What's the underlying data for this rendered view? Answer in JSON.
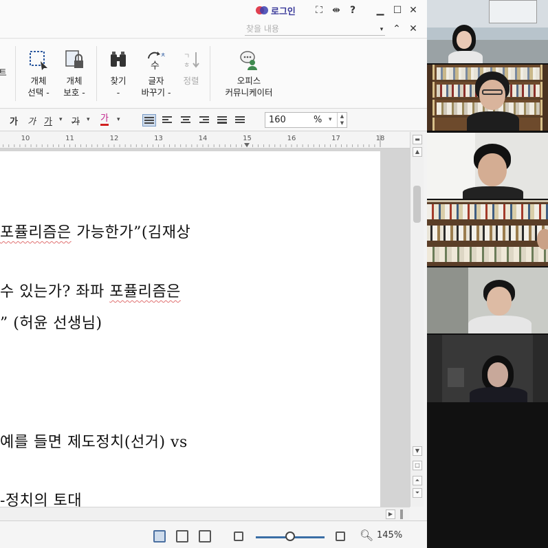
{
  "titlebar": {
    "login_label": "로그인",
    "icons": [
      "fullscreen-icon",
      "split-icon",
      "help-icon",
      "minimize-icon",
      "maximize-icon",
      "close-icon"
    ],
    "help_glyph": "?"
  },
  "search": {
    "placeholder": "찾을 내용"
  },
  "ribbon": {
    "partial_label": "트",
    "object_select": {
      "line1": "개체",
      "line2": "선택 -"
    },
    "object_protect": {
      "line1": "개체",
      "line2": "보호 -"
    },
    "find": {
      "line1": "찾기",
      "line2": "-"
    },
    "replace_chars": {
      "line1": "글자",
      "line2": "바꾸기 -"
    },
    "sort": {
      "line1": "정렬",
      "line2": ""
    },
    "office_communicator": {
      "line1": "오피스",
      "line2": "커뮤니케이터"
    }
  },
  "formatting": {
    "bold_glyph": "가",
    "italic_glyph": "가",
    "underline_glyph": "가",
    "strike_glyph": "가",
    "color_glyph": "가",
    "zoom_value": "160",
    "zoom_unit": "%"
  },
  "ruler": {
    "labels": [
      "10",
      "11",
      "12",
      "13",
      "14",
      "15",
      "16",
      "17",
      "18"
    ]
  },
  "document": {
    "lines": [
      {
        "pre": "",
        "squiggle": "포퓰리즘은",
        "post": "  가능한가”(김재상"
      },
      {
        "pre": "  수  있는가?  좌파  ",
        "squiggle": "포퓰리즘은",
        "post": ""
      },
      {
        "pre": "”  (허윤  선생님)",
        "squiggle": "",
        "post": ""
      },
      {
        "pre": "예를  들면  제도정치(선거)  vs",
        "squiggle": "",
        "post": ""
      },
      {
        "pre": "-정치의  토대",
        "squiggle": "",
        "post": ""
      }
    ]
  },
  "status": {
    "zoom_percent": "145%",
    "zoom_level": 0.5
  },
  "participants": [
    {
      "name": "participant-1"
    },
    {
      "name": "participant-2"
    },
    {
      "name": "participant-3"
    },
    {
      "name": "participant-4"
    },
    {
      "name": "participant-5"
    },
    {
      "name": "participant-6"
    }
  ]
}
